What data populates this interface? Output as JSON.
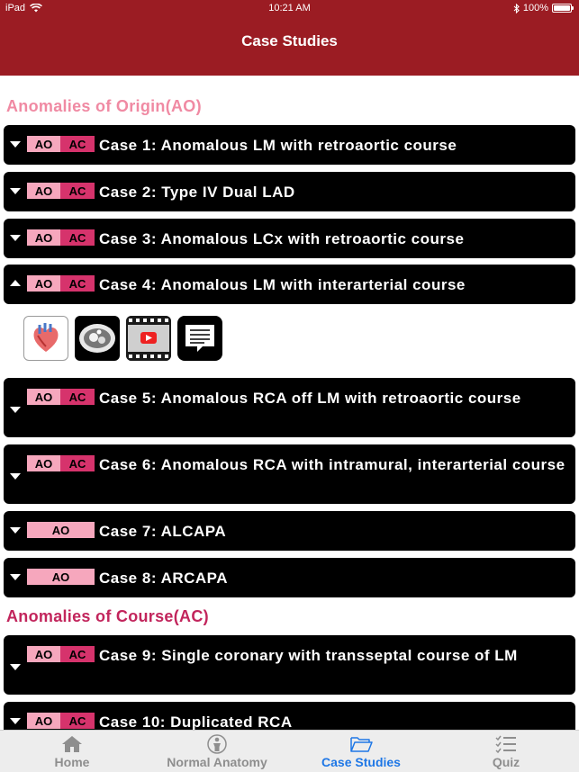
{
  "status_bar": {
    "device": "iPad",
    "time": "10:21 AM",
    "battery": "100%"
  },
  "nav": {
    "title": "Case Studies"
  },
  "tag_labels": {
    "ao": "AO",
    "ac": "AC"
  },
  "sections": {
    "origin": "Anomalies of Origin(AO)",
    "course": "Anomalies of Course(AC)"
  },
  "cases": [
    {
      "title": "Case 1: Anomalous LM with retroaortic course",
      "tags": [
        "AO",
        "AC"
      ],
      "expanded": false
    },
    {
      "title": "Case 2: Type IV Dual LAD",
      "tags": [
        "AO",
        "AC"
      ],
      "expanded": false
    },
    {
      "title": "Case 3: Anomalous LCx with retroaortic course",
      "tags": [
        "AO",
        "AC"
      ],
      "expanded": false
    },
    {
      "title": "Case 4: Anomalous LM with interarterial course",
      "tags": [
        "AO",
        "AC"
      ],
      "expanded": true
    },
    {
      "title": "Case 5: Anomalous RCA off LM with retroaortic course",
      "tags": [
        "AO",
        "AC"
      ],
      "expanded": false
    },
    {
      "title": "Case 6: Anomalous RCA with intramural, interarterial course",
      "tags": [
        "AO",
        "AC"
      ],
      "expanded": false
    },
    {
      "title": "Case 7: ALCAPA",
      "tags": [
        "AO"
      ],
      "expanded": false
    },
    {
      "title": "Case 8: ARCAPA",
      "tags": [
        "AO"
      ],
      "expanded": false
    },
    {
      "title": "Case 9: Single coronary with transseptal course of LM",
      "tags": [
        "AO",
        "AC"
      ],
      "expanded": false
    },
    {
      "title": "Case 10: Duplicated RCA",
      "tags": [
        "AO",
        "AC"
      ],
      "expanded": false
    }
  ],
  "media_icons": [
    "heart-illustration-icon",
    "ct-scan-icon",
    "video-icon",
    "text-notes-icon"
  ],
  "tabs": [
    {
      "label": "Home",
      "icon": "home-icon",
      "active": false
    },
    {
      "label": "Normal Anatomy",
      "icon": "anatomy-icon",
      "active": false
    },
    {
      "label": "Case Studies",
      "icon": "folder-icon",
      "active": true
    },
    {
      "label": "Quiz",
      "icon": "checklist-icon",
      "active": false
    }
  ],
  "colors": {
    "header": "#9b1c23",
    "ao_tag": "#f6a7bd",
    "ac_tag": "#d6336c",
    "section_origin": "#f08aa3",
    "section_course": "#c2255c",
    "active_tab": "#1e77e6"
  }
}
